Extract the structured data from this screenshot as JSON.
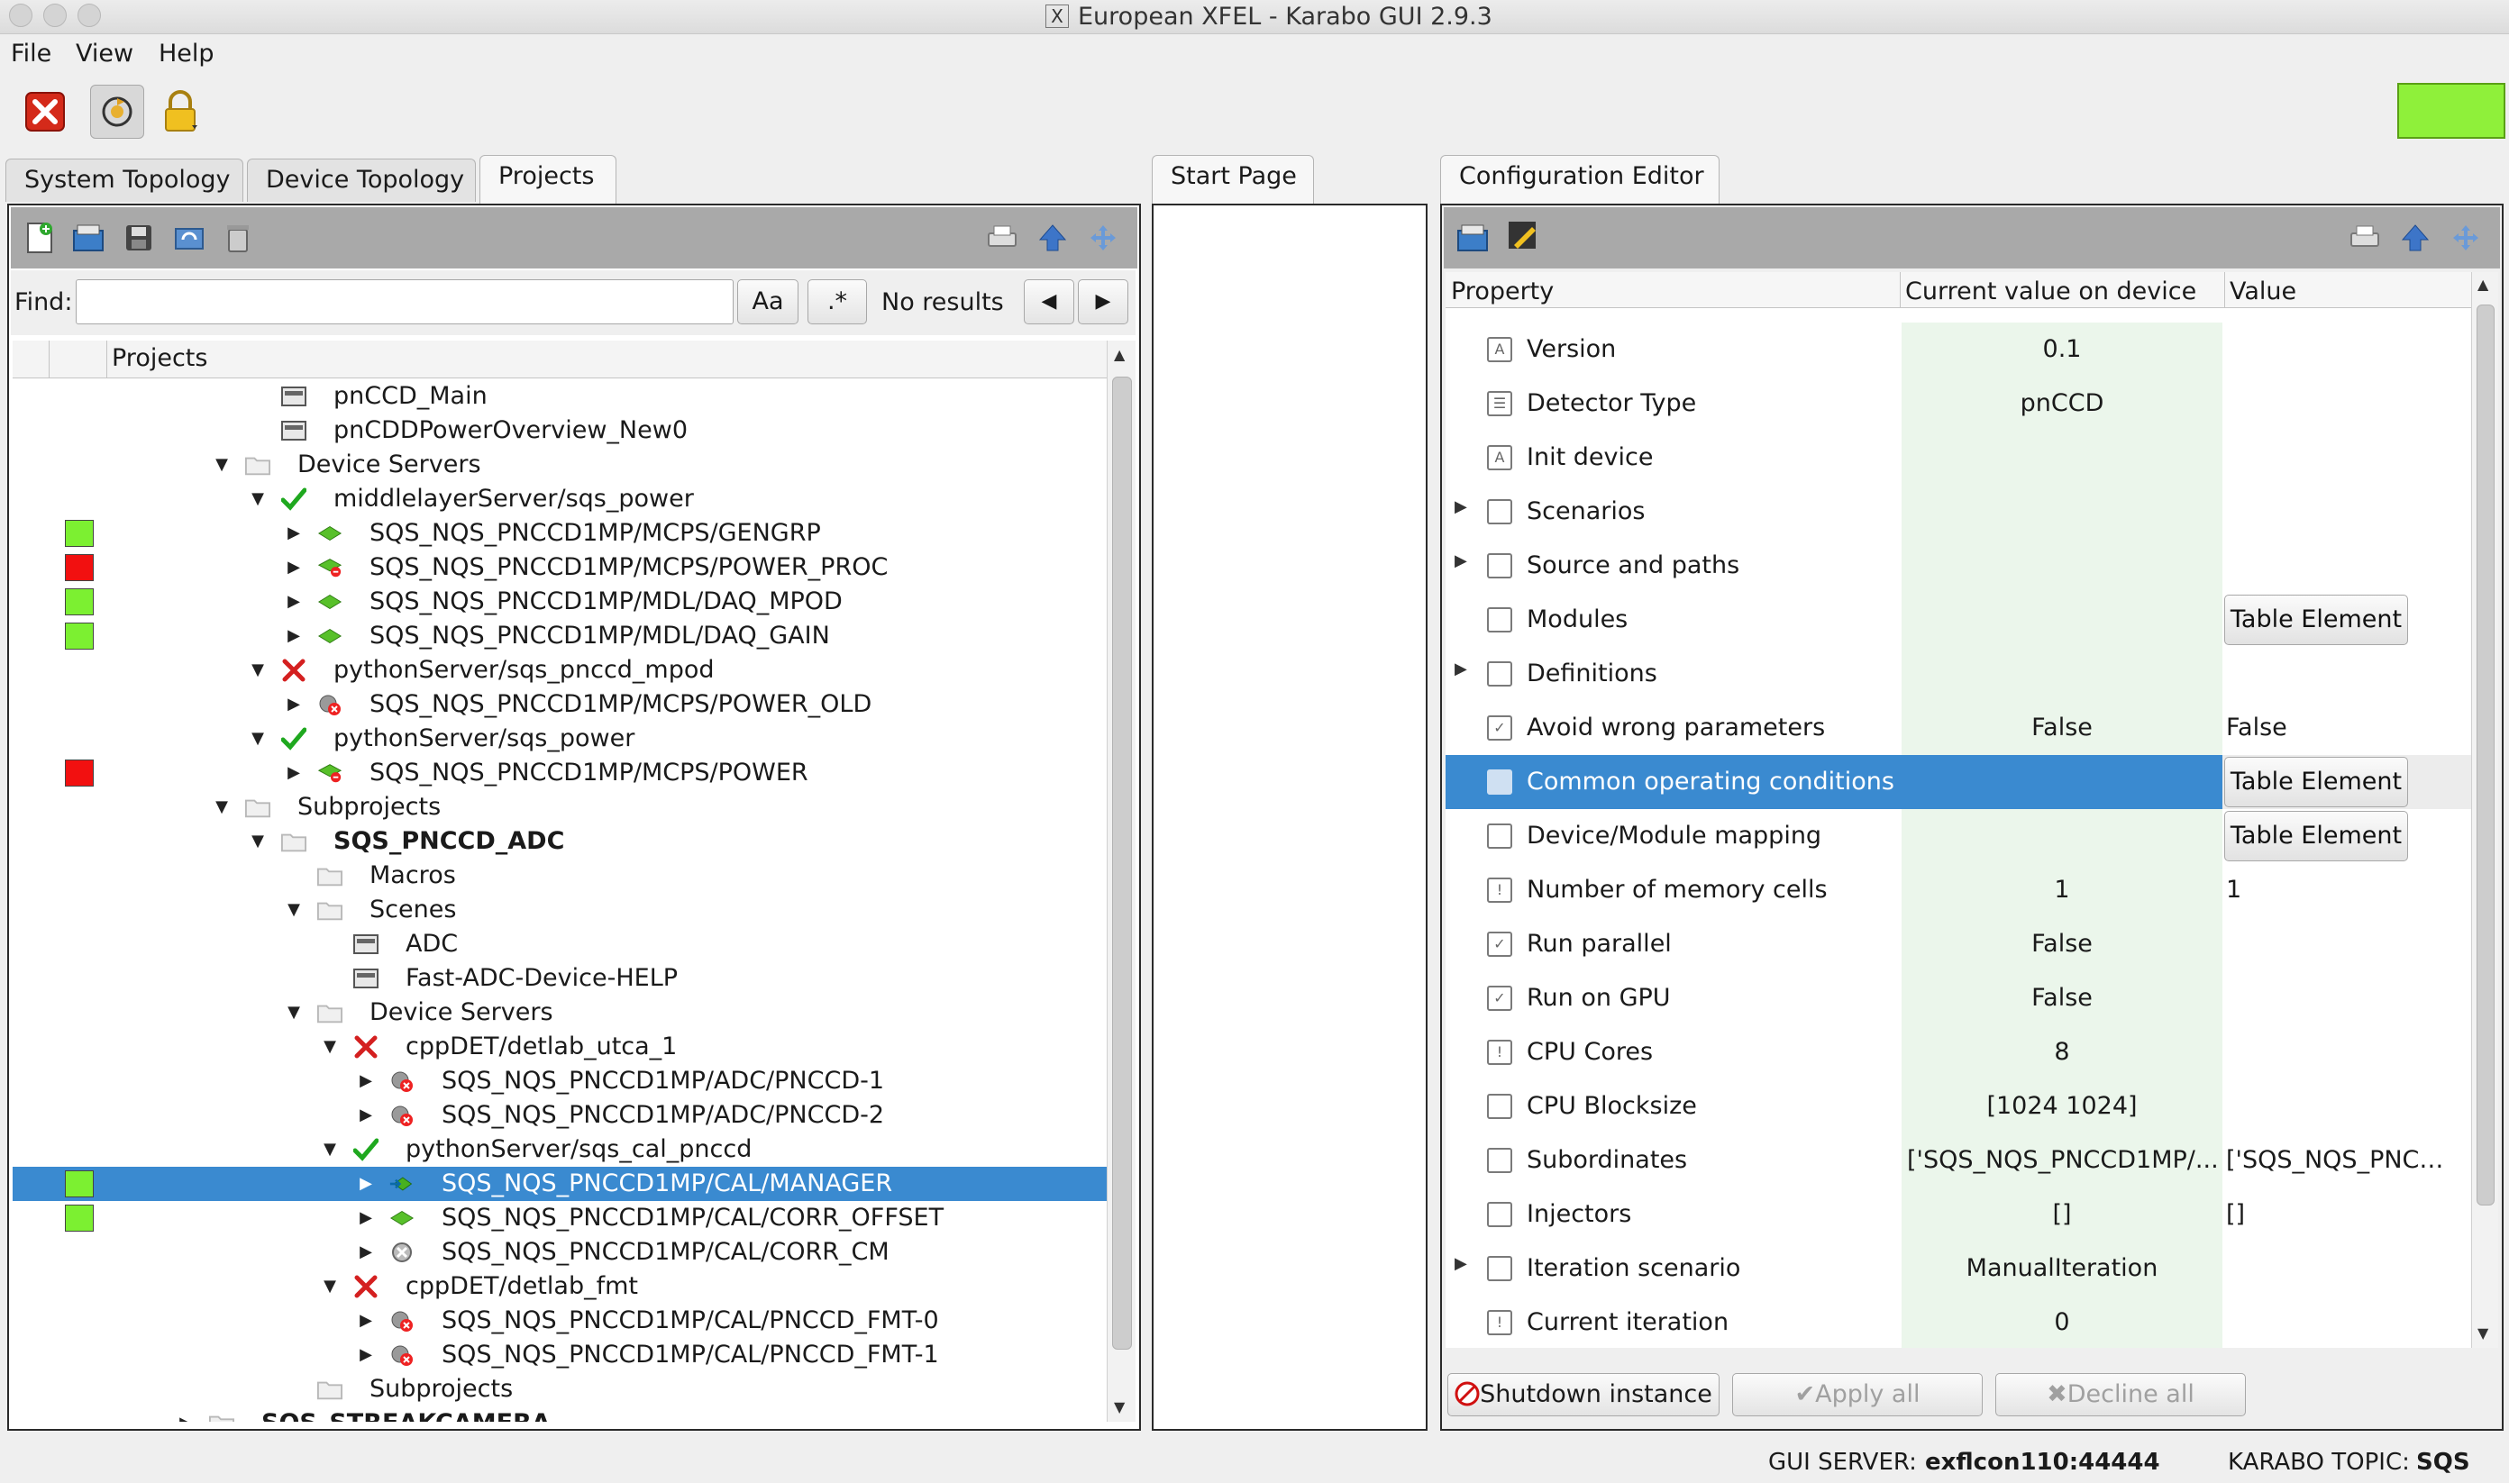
{
  "window": {
    "title": "European XFEL - Karabo GUI 2.9.3",
    "title_icon": "X"
  },
  "menu": {
    "file": "File",
    "view": "View",
    "help": "Help"
  },
  "toolbar": {
    "icons": [
      "disconnect-icon",
      "refresh-icon",
      "lock-icon"
    ],
    "indicator_color": "#8ff03a"
  },
  "left_tabs": [
    {
      "label": "System Topology"
    },
    {
      "label": "Device Topology"
    },
    {
      "label": "Projects"
    }
  ],
  "center_tab": {
    "label": "Start Page"
  },
  "right_tab": {
    "label": "Configuration Editor"
  },
  "find": {
    "label": "Find:",
    "value": "",
    "case_button": "Aa",
    "regex_button": ".*",
    "result": "No results"
  },
  "tree": {
    "header": "Projects",
    "rows": [
      {
        "text": "pnCCD_Main"
      },
      {
        "text": "pnCDDPowerOverview_New0"
      },
      {
        "text": "Device Servers"
      },
      {
        "text": "middlelayerServer/sqs_power"
      },
      {
        "text": "SQS_NQS_PNCCD1MP/MCPS/GENGRP"
      },
      {
        "text": "SQS_NQS_PNCCD1MP/MCPS/POWER_PROC"
      },
      {
        "text": "SQS_NQS_PNCCD1MP/MDL/DAQ_MPOD"
      },
      {
        "text": "SQS_NQS_PNCCD1MP/MDL/DAQ_GAIN"
      },
      {
        "text": "pythonServer/sqs_pnccd_mpod"
      },
      {
        "text": "SQS_NQS_PNCCD1MP/MCPS/POWER_OLD"
      },
      {
        "text": "pythonServer/sqs_power"
      },
      {
        "text": "SQS_NQS_PNCCD1MP/MCPS/POWER"
      },
      {
        "text": "Subprojects"
      },
      {
        "text": "SQS_PNCCD_ADC"
      },
      {
        "text": "Macros"
      },
      {
        "text": "Scenes"
      },
      {
        "text": "ADC"
      },
      {
        "text": "Fast-ADC-Device-HELP"
      },
      {
        "text": "Device Servers"
      },
      {
        "text": "cppDET/detlab_utca_1"
      },
      {
        "text": "SQS_NQS_PNCCD1MP/ADC/PNCCD-1"
      },
      {
        "text": "SQS_NQS_PNCCD1MP/ADC/PNCCD-2"
      },
      {
        "text": "pythonServer/sqs_cal_pnccd"
      },
      {
        "text": "SQS_NQS_PNCCD1MP/CAL/MANAGER"
      },
      {
        "text": "SQS_NQS_PNCCD1MP/CAL/CORR_OFFSET"
      },
      {
        "text": "SQS_NQS_PNCCD1MP/CAL/CORR_CM"
      },
      {
        "text": "cppDET/detlab_fmt"
      },
      {
        "text": "SQS_NQS_PNCCD1MP/CAL/PNCCD_FMT-0"
      },
      {
        "text": "SQS_NQS_PNCCD1MP/CAL/PNCCD_FMT-1"
      },
      {
        "text": "Subprojects"
      },
      {
        "text": "SQS_STREAKCAMERA"
      }
    ]
  },
  "config": {
    "headers": {
      "property": "Property",
      "current": "Current value on device",
      "value": "Value"
    },
    "rows": [
      {
        "name": "Version",
        "current": "0.1",
        "value": ""
      },
      {
        "name": "Detector Type",
        "current": "pnCCD",
        "value": ""
      },
      {
        "name": "Init device",
        "current": "",
        "value": ""
      },
      {
        "name": "Scenarios",
        "current": "",
        "value": ""
      },
      {
        "name": "Source and paths",
        "current": "",
        "value": ""
      },
      {
        "name": "Modules",
        "current": "",
        "value": "Table Element"
      },
      {
        "name": "Definitions",
        "current": "",
        "value": ""
      },
      {
        "name": "Avoid wrong parameters",
        "current": "False",
        "value": "False"
      },
      {
        "name": "Common operating conditions",
        "current": "",
        "value": "Table Element"
      },
      {
        "name": "Device/Module mapping",
        "current": "",
        "value": "Table Element"
      },
      {
        "name": "Number of memory cells",
        "current": "1",
        "value": "1"
      },
      {
        "name": "Run parallel",
        "current": "False",
        "value": ""
      },
      {
        "name": "Run on GPU",
        "current": "False",
        "value": ""
      },
      {
        "name": "CPU Cores",
        "current": "8",
        "value": ""
      },
      {
        "name": "CPU Blocksize",
        "current": "[1024 1024]",
        "value": ""
      },
      {
        "name": "Subordinates",
        "current": "['SQS_NQS_PNCCD1MP/...",
        "value": "['SQS_NQS_PNCC..."
      },
      {
        "name": "Injectors",
        "current": "[]",
        "value": "[]"
      },
      {
        "name": "Iteration scenario",
        "current": "ManualIteration",
        "value": ""
      },
      {
        "name": "Current iteration",
        "current": "0",
        "value": ""
      }
    ],
    "buttons": {
      "shutdown": "Shutdown instance",
      "apply": "Apply all",
      "decline": "Decline all"
    }
  },
  "status": {
    "server_label": "GUI SERVER:",
    "server_value": "exflcon110:44444",
    "topic_label": "KARABO TOPIC:",
    "topic_value": "SQS"
  }
}
